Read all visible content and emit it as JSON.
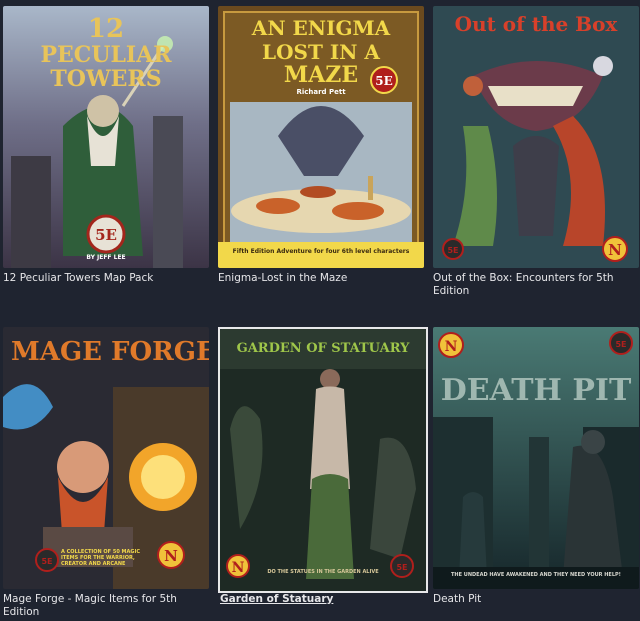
{
  "products": [
    {
      "caption": "12 Peculiar Towers Map Pack",
      "cover_title_1": "12",
      "cover_title_2": "PECULIAR",
      "cover_title_3": "TOWERS",
      "badge": "5E",
      "author": "BY JEFF LEE"
    },
    {
      "caption": "Enigma-Lost in the Maze",
      "cover_title_1": "AN ENIGMA",
      "cover_title_2": "LOST IN A",
      "cover_title_3": "MAZE",
      "author": "Richard Pett",
      "badge": "5E",
      "banner": "Fifth Edition Adventure for four 6th level characters"
    },
    {
      "caption": "Out of the Box: Encounters for 5th Edition",
      "cover_title_1": "Out of the Box",
      "badge": "5E",
      "logo": "N"
    },
    {
      "caption": "Mage Forge - Magic Items for 5th Edition",
      "cover_title_1": "MAGE FORGE",
      "badge": "5E",
      "logo": "N",
      "blurb": "A COLLECTION OF 50 MAGIC ITEMS FOR THE WARRIOR, CREATOR AND ARCANE"
    },
    {
      "caption": "Garden of Statuary",
      "cover_title_1": "GARDEN OF STATUARY",
      "badge": "5E",
      "logo": "N",
      "blurb": "DO THE STATUES IN THE GARDEN ALIVE"
    },
    {
      "caption": "Death Pit",
      "cover_title_1": "DEATH PIT",
      "badge": "5E",
      "logo": "N",
      "blurb": "THE UNDEAD HAVE AWAKENED AND THEY NEED YOUR HELP!"
    }
  ]
}
